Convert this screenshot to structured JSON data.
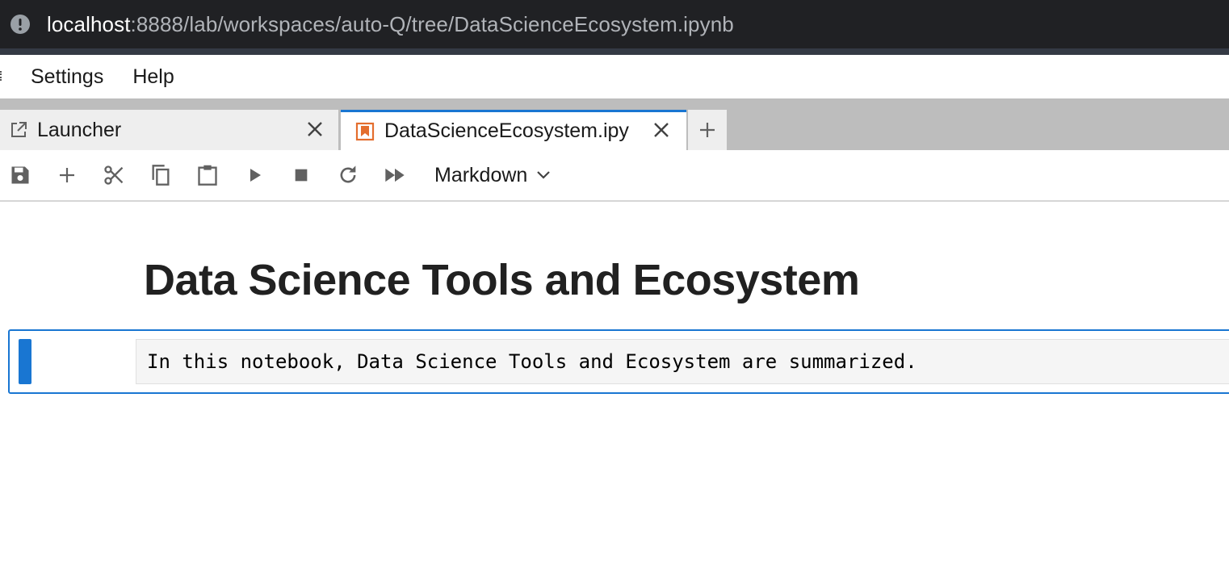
{
  "browser": {
    "url_host": "localhost",
    "url_rest": ":8888/lab/workspaces/auto-Q/tree/DataScienceEcosystem.ipynb",
    "info_icon": "info-circle-icon"
  },
  "menubar": {
    "items": [
      {
        "label": "Settings"
      },
      {
        "label": "Help"
      }
    ]
  },
  "tabs": [
    {
      "label": "Launcher",
      "icon": "launcher-icon",
      "active": false
    },
    {
      "label": "DataScienceEcosystem.ipy",
      "icon": "notebook-icon",
      "active": true
    }
  ],
  "toolbar": {
    "buttons": [
      "save-icon",
      "add-icon",
      "cut-icon",
      "copy-icon",
      "paste-icon",
      "run-icon",
      "stop-icon",
      "restart-icon",
      "fast-forward-icon"
    ],
    "cell_type": "Markdown"
  },
  "notebook": {
    "heading": "Data Science Tools and Ecosystem",
    "cell_source": "In this notebook, Data Science Tools and Ecosystem are summarized."
  },
  "colors": {
    "accent": "#1976d2",
    "notebook_icon": "#e46e2e",
    "address_bar": "#202124"
  }
}
